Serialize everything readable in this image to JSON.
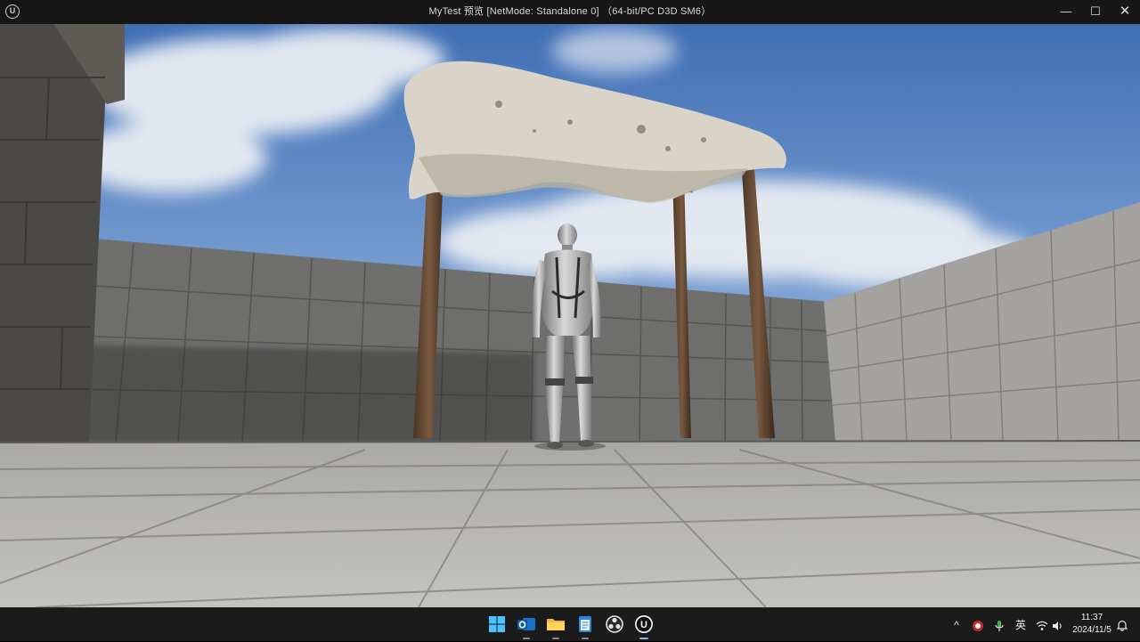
{
  "window": {
    "title": "MyTest 预览 [NetMode: Standalone 0]  （64-bit/PC D3D SM6）",
    "logo_icon": "unreal-engine-icon",
    "minimize_glyph": "—",
    "maximize_glyph": "☐",
    "close_glyph": "✕"
  },
  "viewport": {
    "scene": "game-viewport",
    "sky_color": "#4a76b8",
    "floor_color": "#b9b8b5",
    "wall_color": "#7a7a78"
  },
  "taskbar": {
    "apps": [
      {
        "name": "windows-start-icon"
      },
      {
        "name": "outlook-icon"
      },
      {
        "name": "file-explorer-icon"
      },
      {
        "name": "notepad-icon"
      },
      {
        "name": "obs-icon"
      },
      {
        "name": "unreal-engine-icon",
        "active": true
      }
    ],
    "tray": {
      "chevron": "^",
      "ime": "英",
      "time": "11:37",
      "date": "2024/11/5"
    }
  }
}
